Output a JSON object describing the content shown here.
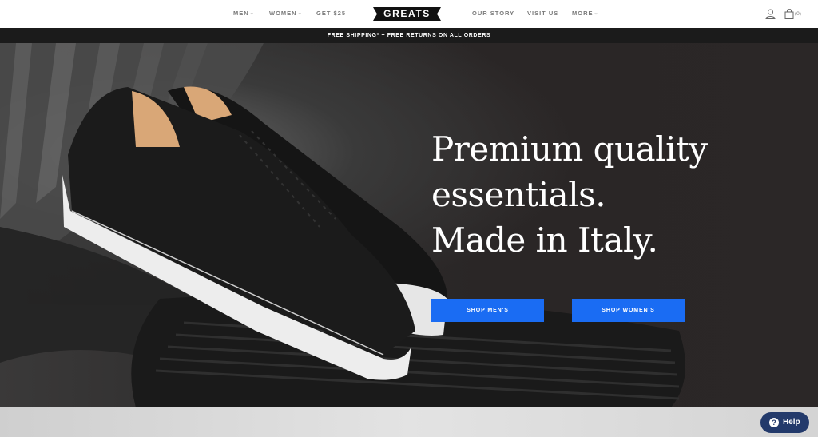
{
  "nav": {
    "left_links": [
      {
        "label": "MEN",
        "dropdown": true
      },
      {
        "label": "WOMEN",
        "dropdown": true
      },
      {
        "label": "GET $25",
        "dropdown": false
      }
    ],
    "logo_text": "GREATS",
    "right_links": [
      {
        "label": "OUR STORY",
        "dropdown": false
      },
      {
        "label": "VISIT US",
        "dropdown": false
      },
      {
        "label": "MORE",
        "dropdown": true
      }
    ],
    "account_icon": "user-icon",
    "cart_icon": "shopping-bag-icon",
    "cart_count": "(0)"
  },
  "announcement": "FREE SHIPPING* + FREE RETURNS ON ALL ORDERS",
  "hero": {
    "headline_lines": [
      "Premium quality",
      "essentials.",
      "Made in Italy."
    ],
    "cta_men": "SHOP MEN'S",
    "cta_women": "SHOP WOMEN'S"
  },
  "help": {
    "label": "Help",
    "icon_glyph": "?"
  },
  "colors": {
    "accent": "#1a6cf3",
    "announcement_bg": "#1b1b1b",
    "help_bg": "#233a6b",
    "nav_text": "#7a7a7a"
  }
}
